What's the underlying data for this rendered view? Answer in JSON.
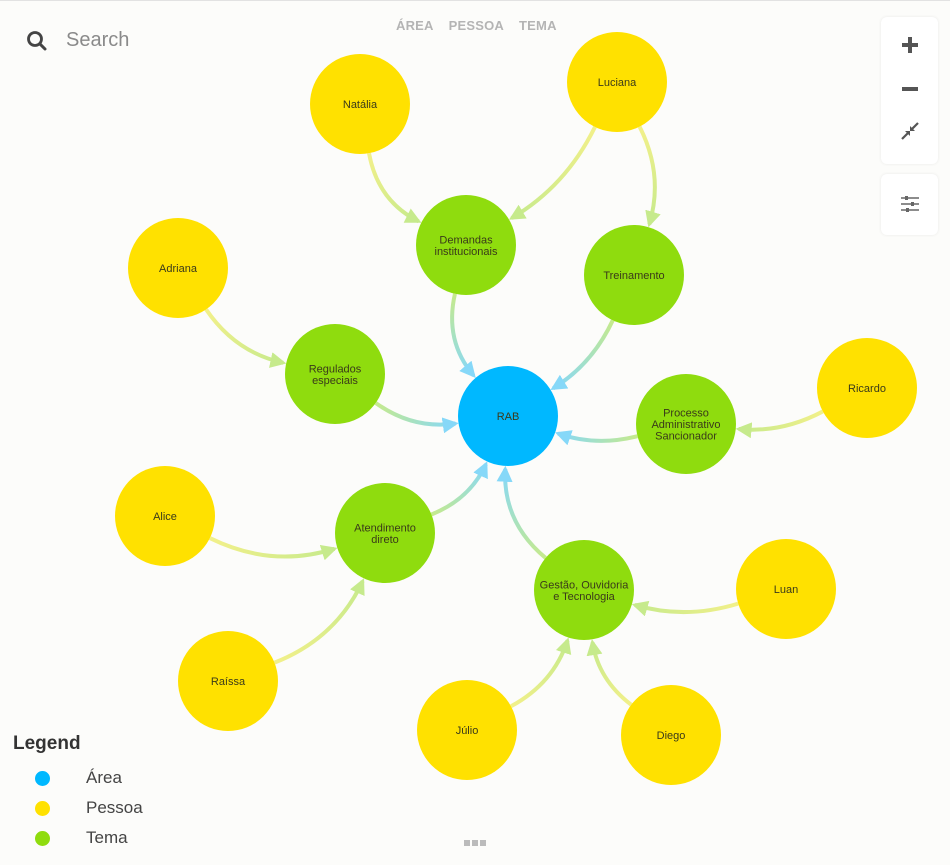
{
  "search": {
    "placeholder": "Search",
    "value": ""
  },
  "filters": [
    "ÁREA",
    "PESSOA",
    "TEMA"
  ],
  "controls": {
    "zoom_in": "zoom-in",
    "zoom_out": "zoom-out",
    "fit": "fit-to-screen",
    "settings": "settings"
  },
  "colors": {
    "area": "#00b8ff",
    "pessoa": "#ffe100",
    "tema": "#8fdc0e"
  },
  "legend": {
    "title": "Legend",
    "items": [
      {
        "label": "Área",
        "type": "area"
      },
      {
        "label": "Pessoa",
        "type": "pessoa"
      },
      {
        "label": "Tema",
        "type": "tema"
      }
    ]
  },
  "graph": {
    "nodes": [
      {
        "id": "rab",
        "label": [
          "RAB"
        ],
        "type": "area"
      },
      {
        "id": "demandas",
        "label": [
          "Demandas",
          "institucionais"
        ],
        "type": "tema"
      },
      {
        "id": "treinamento",
        "label": [
          "Treinamento"
        ],
        "type": "tema"
      },
      {
        "id": "regulados",
        "label": [
          "Regulados",
          "especiais"
        ],
        "type": "tema"
      },
      {
        "id": "processo",
        "label": [
          "Processo",
          "Administrativo",
          "Sancionador"
        ],
        "type": "tema"
      },
      {
        "id": "atendimento",
        "label": [
          "Atendimento",
          "direto"
        ],
        "type": "tema"
      },
      {
        "id": "gestao",
        "label": [
          "Gestão, Ouvidoria",
          "e Tecnologia"
        ],
        "type": "tema"
      },
      {
        "id": "natalia",
        "label": [
          "Natália"
        ],
        "type": "pessoa"
      },
      {
        "id": "luciana",
        "label": [
          "Luciana"
        ],
        "type": "pessoa"
      },
      {
        "id": "adriana",
        "label": [
          "Adriana"
        ],
        "type": "pessoa"
      },
      {
        "id": "ricardo",
        "label": [
          "Ricardo"
        ],
        "type": "pessoa"
      },
      {
        "id": "alice",
        "label": [
          "Alice"
        ],
        "type": "pessoa"
      },
      {
        "id": "raissa",
        "label": [
          "Raíssa"
        ],
        "type": "pessoa"
      },
      {
        "id": "luan",
        "label": [
          "Luan"
        ],
        "type": "pessoa"
      },
      {
        "id": "julio",
        "label": [
          "Júlio"
        ],
        "type": "pessoa"
      },
      {
        "id": "diego",
        "label": [
          "Diego"
        ],
        "type": "pessoa"
      }
    ],
    "edges": [
      {
        "from": "natalia",
        "to": "demandas"
      },
      {
        "from": "luciana",
        "to": "demandas"
      },
      {
        "from": "luciana",
        "to": "treinamento"
      },
      {
        "from": "adriana",
        "to": "regulados"
      },
      {
        "from": "ricardo",
        "to": "processo"
      },
      {
        "from": "alice",
        "to": "atendimento"
      },
      {
        "from": "raissa",
        "to": "atendimento"
      },
      {
        "from": "luan",
        "to": "gestao"
      },
      {
        "from": "julio",
        "to": "gestao"
      },
      {
        "from": "diego",
        "to": "gestao"
      },
      {
        "from": "demandas",
        "to": "rab"
      },
      {
        "from": "treinamento",
        "to": "rab"
      },
      {
        "from": "regulados",
        "to": "rab"
      },
      {
        "from": "processo",
        "to": "rab"
      },
      {
        "from": "atendimento",
        "to": "rab"
      },
      {
        "from": "gestao",
        "to": "rab"
      }
    ]
  }
}
